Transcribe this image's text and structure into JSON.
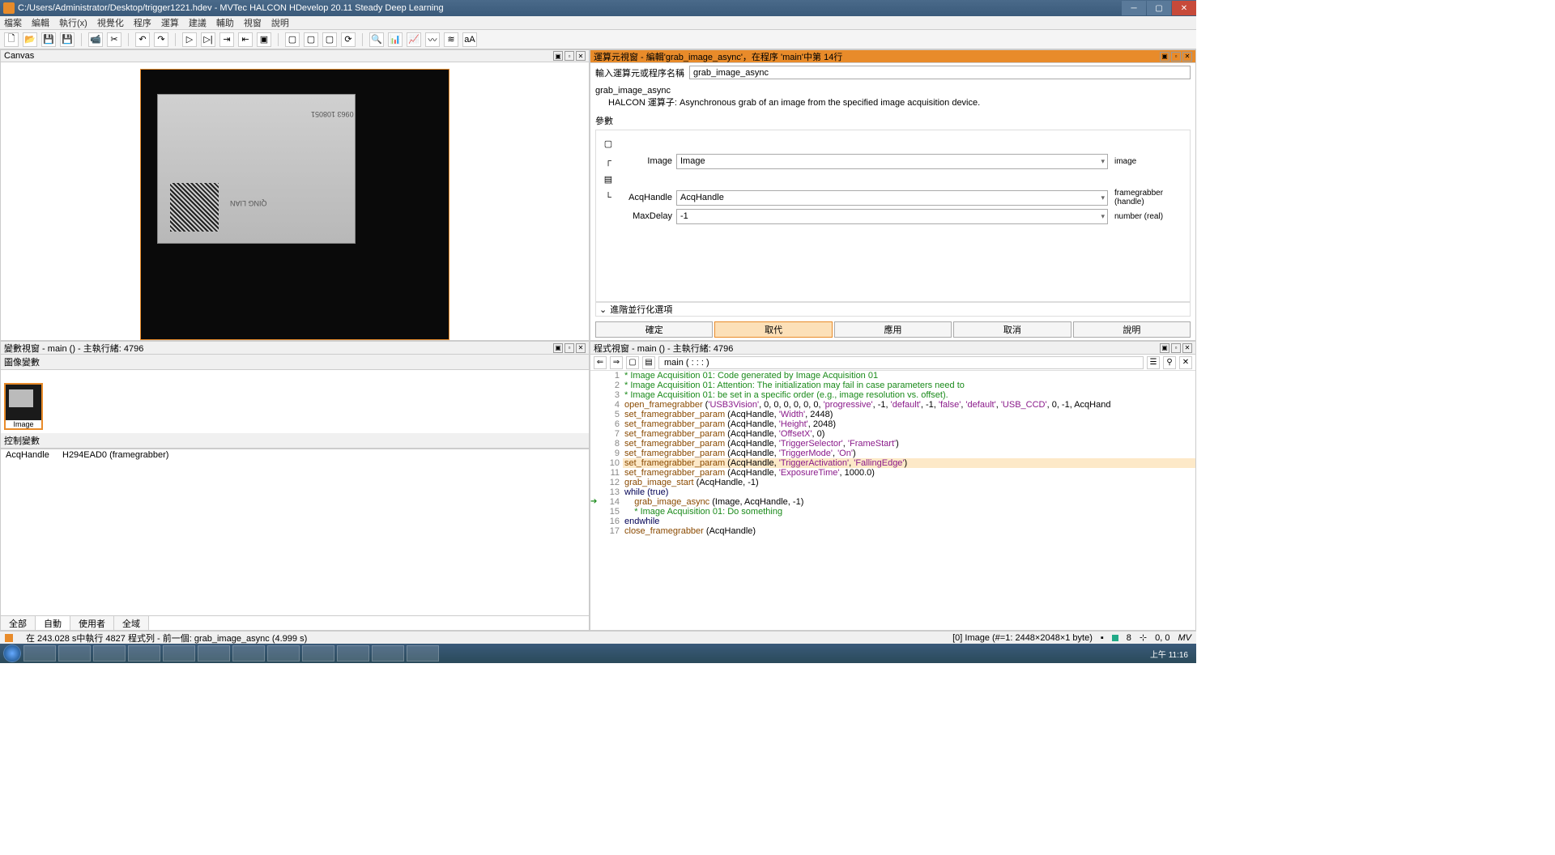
{
  "titlebar": {
    "path": "C:/Users/Administrator/Desktop/trigger1221.hdev - MVTec HALCON HDevelop 20.11 Steady Deep Learning"
  },
  "menu": [
    "檔案",
    "編輯",
    "執行(x)",
    "視覺化",
    "程序",
    "運算",
    "建議",
    "輔助",
    "視窗",
    "說明"
  ],
  "canvas": {
    "title": "Canvas"
  },
  "op_panel": {
    "title": "運算元視窗 - 編輯'grab_image_async'，在程序 'main'中第 14行",
    "input_label": "輸入運算元或程序名稱",
    "input_value": "grab_image_async",
    "name": "grab_image_async",
    "desc_label": "HALCON 運算子:",
    "desc": "Asynchronous grab of an image from the specified image acquisition device.",
    "params_h": "參數",
    "params": [
      {
        "lbl": "Image",
        "val": "Image",
        "hint": "image"
      },
      {
        "lbl": "AcqHandle",
        "val": "AcqHandle",
        "hint": "framegrabber (handle)"
      },
      {
        "lbl": "MaxDelay",
        "val": "-1",
        "hint": "number (real)"
      }
    ],
    "adv": "進階並行化選項",
    "buttons": {
      "ok": "確定",
      "replace": "取代",
      "apply": "應用",
      "cancel": "取消",
      "help": "說明"
    }
  },
  "var_panel": {
    "title": "變數視窗 - main () - 主執行緒: 4796",
    "img_h": "圖像變數",
    "thumb_label": "Image",
    "ctrl_h": "控制變數",
    "rows": [
      [
        "AcqHandle",
        "H294EAD0 (framegrabber)"
      ]
    ],
    "tabs": [
      "全部",
      "自動",
      "使用者",
      "全域"
    ],
    "active_tab": 1
  },
  "code_panel": {
    "title": "程式視窗 - main () - 主執行緒: 4796",
    "crumb": "main ( : : : )",
    "lines": [
      {
        "n": 1,
        "t": "comment",
        "txt": "* Image Acquisition 01: Code generated by Image Acquisition 01"
      },
      {
        "n": 2,
        "t": "comment",
        "txt": "* Image Acquisition 01: Attention: The initialization may fail in case parameters need to"
      },
      {
        "n": 3,
        "t": "comment",
        "txt": "* Image Acquisition 01: be set in a specific order (e.g., image resolution vs. offset)."
      },
      {
        "n": 4,
        "t": "call",
        "op": "open_framegrabber",
        "args": " ('USB3Vision', 0, 0, 0, 0, 0, 0, 'progressive', -1, 'default', -1, 'false', 'default', 'USB_CCD', 0, -1, AcqHand"
      },
      {
        "n": 5,
        "t": "call",
        "op": "set_framegrabber_param",
        "args": " (AcqHandle, 'Width', 2448)"
      },
      {
        "n": 6,
        "t": "call",
        "op": "set_framegrabber_param",
        "args": " (AcqHandle, 'Height', 2048)"
      },
      {
        "n": 7,
        "t": "call",
        "op": "set_framegrabber_param",
        "args": " (AcqHandle, 'OffsetX', 0)"
      },
      {
        "n": 8,
        "t": "call",
        "op": "set_framegrabber_param",
        "args": " (AcqHandle, 'TriggerSelector', 'FrameStart')"
      },
      {
        "n": 9,
        "t": "call",
        "op": "set_framegrabber_param",
        "args": " (AcqHandle, 'TriggerMode', 'On')"
      },
      {
        "n": 10,
        "t": "call",
        "hl": true,
        "op": "set_framegrabber_param",
        "args": " (AcqHandle, 'TriggerActivation', 'FallingEdge')"
      },
      {
        "n": 11,
        "t": "call",
        "op": "set_framegrabber_param",
        "args": " (AcqHandle, 'ExposureTime', 1000.0)"
      },
      {
        "n": 12,
        "t": "call",
        "op": "grab_image_start",
        "args": " (AcqHandle, -1)"
      },
      {
        "n": 13,
        "t": "kw",
        "txt": "while (true)"
      },
      {
        "n": 14,
        "t": "call",
        "arrow": true,
        "indent": true,
        "op": "grab_image_async",
        "args": " (Image, AcqHandle, -1)"
      },
      {
        "n": 15,
        "t": "comment",
        "indent": true,
        "txt": "* Image Acquisition 01: Do something"
      },
      {
        "n": 16,
        "t": "kw",
        "txt": "endwhile"
      },
      {
        "n": 17,
        "t": "call",
        "op": "close_framegrabber",
        "args": " (AcqHandle)"
      }
    ]
  },
  "status": {
    "left": "在 243.028 s中執行 4827 程式列  - 前一個: grab_image_async (4.999 s)",
    "img_info": "[0] Image (#=1: 2448×2048×1 byte)",
    "count": "8",
    "coord": "0, 0"
  },
  "clock": "上午 11:16"
}
